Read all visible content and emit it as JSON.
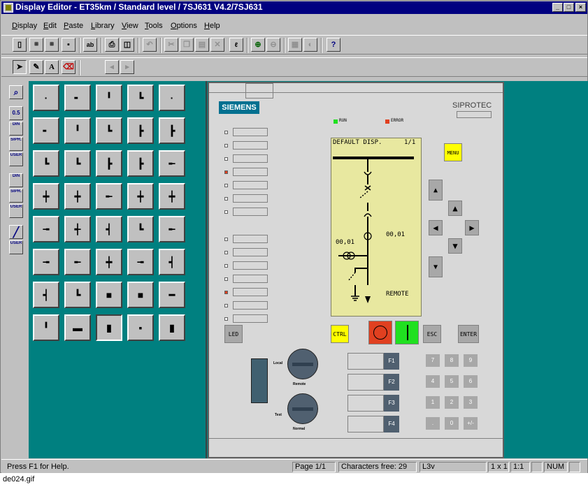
{
  "window": {
    "title": "Display Editor - ET35km / Standard level / 7SJ631 V4.2/7SJ631"
  },
  "menu": [
    "Display",
    "Edit",
    "Paste",
    "Library",
    "View",
    "Tools",
    "Options",
    "Help"
  ],
  "toolbar_icons": [
    "new-icon",
    "open-icon",
    "open2-icon",
    "save-icon",
    "spell-icon",
    "print-icon",
    "preview-icon",
    "undo-icon",
    "cut-icon",
    "copy-icon",
    "paste-icon",
    "delete-icon",
    "special-icon",
    "zoom-in-icon",
    "zoom-out-icon",
    "grid-icon",
    "contrast-icon",
    "help-icon"
  ],
  "toolbar2": {
    "text_tool_label": "A"
  },
  "palette_labels": [
    "0.5",
    "DIN",
    "SIPR.",
    "USER",
    "DIN",
    "SIPR.",
    "USER",
    "USER"
  ],
  "device": {
    "brand": "SIEMENS",
    "product": "SIPROTEC",
    "run_label": "RUN",
    "error_label": "ERROR",
    "menu_label": "MENU",
    "led_label": "LED",
    "ctrl_label": "CTRL",
    "esc_label": "ESC",
    "enter_label": "ENTER",
    "lcd": {
      "title": "DEFAULT DISP.",
      "page": "1/1",
      "value1": "00,01",
      "value2": "00,01",
      "mode": "REMOTE"
    },
    "switch1": {
      "top": "Local",
      "bottom": "Remote"
    },
    "switch2": {
      "top": "Test",
      "bottom": "Normal"
    },
    "fkeys": [
      "F1",
      "F2",
      "F3",
      "F4"
    ],
    "numpad": [
      "7",
      "8",
      "9",
      "4",
      "5",
      "6",
      "1",
      "2",
      "3",
      ".",
      "0",
      "+/-"
    ]
  },
  "status": {
    "help": "Press F1 for Help.",
    "page": "Page 1/1",
    "chars": "Characters free: 29",
    "layer": "L3v",
    "size": "1 x 1",
    "scale": "1:1",
    "num": "NUM"
  },
  "caption": "de024.gif",
  "colors": {
    "title_bg": "#000080",
    "canvas": "#008080",
    "menu_key": "#ffff00",
    "ctrl_key": "#ffff00",
    "red_key": "#e04020",
    "green_key": "#20e020"
  }
}
